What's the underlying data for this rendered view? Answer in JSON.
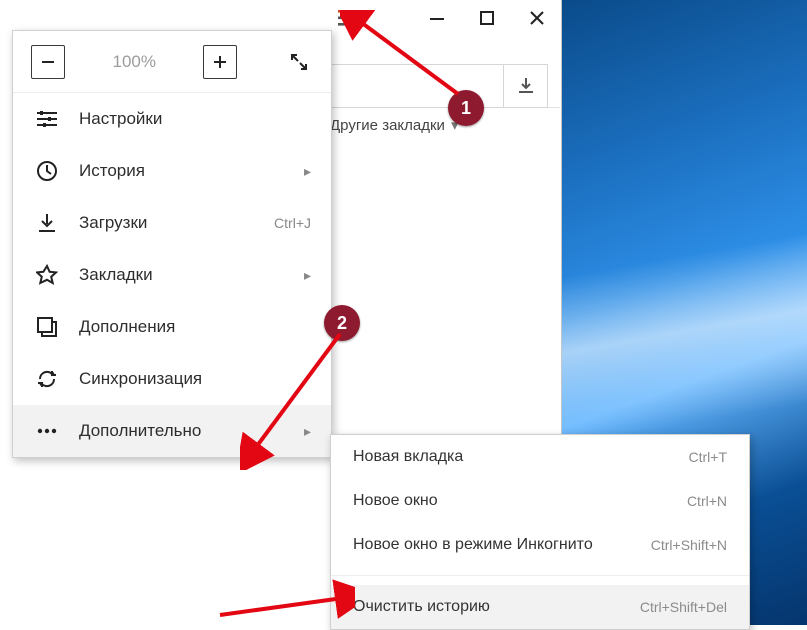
{
  "window": {
    "minimize": "—",
    "maximize": "☐",
    "close": "✕"
  },
  "toolbar": {
    "other_bookmarks": "Другие закладки"
  },
  "menu": {
    "zoom_value": "100%",
    "items": [
      {
        "label": "Настройки",
        "shortcut": "",
        "chev": false
      },
      {
        "label": "История",
        "shortcut": "",
        "chev": true
      },
      {
        "label": "Загрузки",
        "shortcut": "Ctrl+J",
        "chev": false
      },
      {
        "label": "Закладки",
        "shortcut": "",
        "chev": true
      },
      {
        "label": "Дополнения",
        "shortcut": "",
        "chev": false
      },
      {
        "label": "Синхронизация",
        "shortcut": "",
        "chev": false
      },
      {
        "label": "Дополнительно",
        "shortcut": "",
        "chev": true
      }
    ]
  },
  "submenu": {
    "items": [
      {
        "label": "Новая вкладка",
        "shortcut": "Ctrl+T"
      },
      {
        "label": "Новое окно",
        "shortcut": "Ctrl+N"
      },
      {
        "label": "Новое окно в режиме Инкогнито",
        "shortcut": "Ctrl+Shift+N"
      },
      {
        "label": "Очистить историю",
        "shortcut": "Ctrl+Shift+Del"
      }
    ]
  },
  "callouts": {
    "one": "1",
    "two": "2"
  }
}
